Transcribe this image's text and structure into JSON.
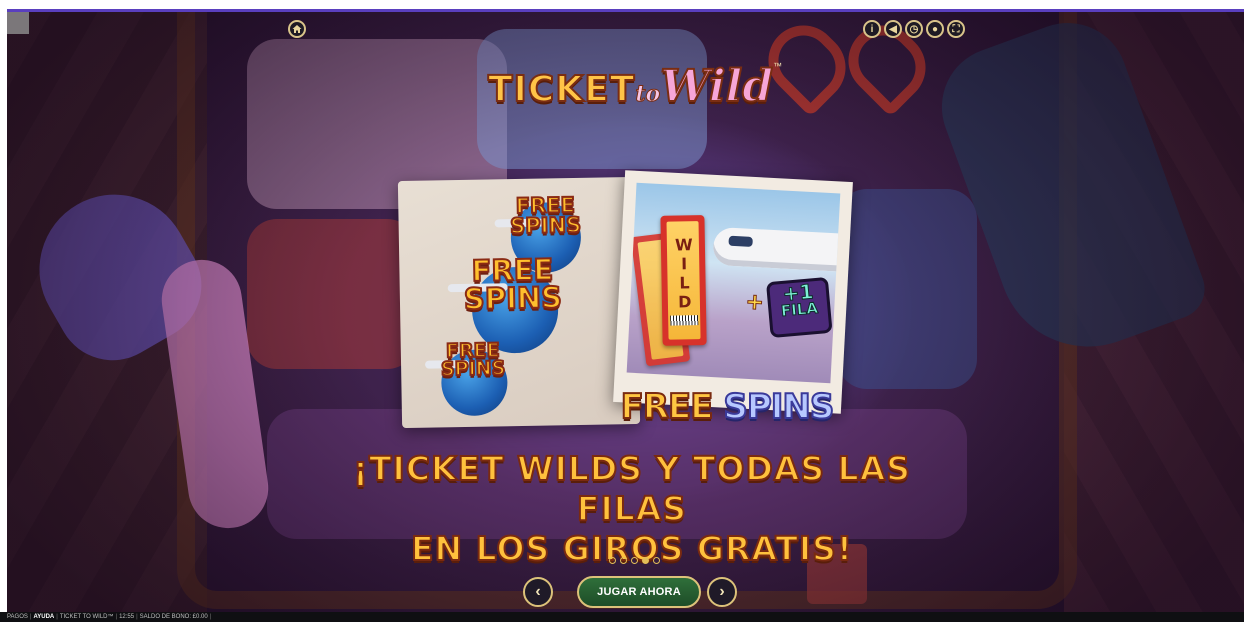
{
  "game": {
    "logo": {
      "part1": "TICKET",
      "part2": "to",
      "part3": "Wild",
      "tm": "™"
    }
  },
  "hud": {
    "home_icon": "home-icon",
    "right_icons": [
      {
        "name": "info-icon",
        "glyph": "i"
      },
      {
        "name": "sound-icon",
        "glyph": "◀"
      },
      {
        "name": "history-icon",
        "glyph": "◷"
      },
      {
        "name": "settings-icon",
        "glyph": "●"
      },
      {
        "name": "fullscreen-icon",
        "glyph": "⛶"
      }
    ]
  },
  "slide": {
    "badges": [
      {
        "line1": "FREE",
        "line2": "SPINS"
      },
      {
        "line1": "FREE",
        "line2": "SPINS"
      },
      {
        "line1": "FREE",
        "line2": "SPINS"
      }
    ],
    "ticket_text": "WILD",
    "plus": "+",
    "row_number": "+1",
    "row_label": "FILA",
    "feature_title_1": "FREE",
    "feature_title_2": "SPINS",
    "headline_line1": "¡TICKET WILDS Y TODAS LAS FILAS",
    "headline_line2": "EN LOS GIROS GRATIS!"
  },
  "pagination": {
    "total": 5,
    "active_index": 3
  },
  "controls": {
    "prev_glyph": "‹",
    "next_glyph": "›",
    "play_label": "JUGAR AHORA"
  },
  "footer": {
    "pagos": "PAGOS",
    "ayuda": "AYUDA",
    "game_name": "TICKET TO WILD™",
    "time": "12:55",
    "bonus_label": "SALDO DE BONO: £0.00"
  },
  "colors": {
    "accent_gold": "#ffc13d",
    "play_green": "#2f6f3a",
    "top_bar": "#5a3fbf"
  }
}
